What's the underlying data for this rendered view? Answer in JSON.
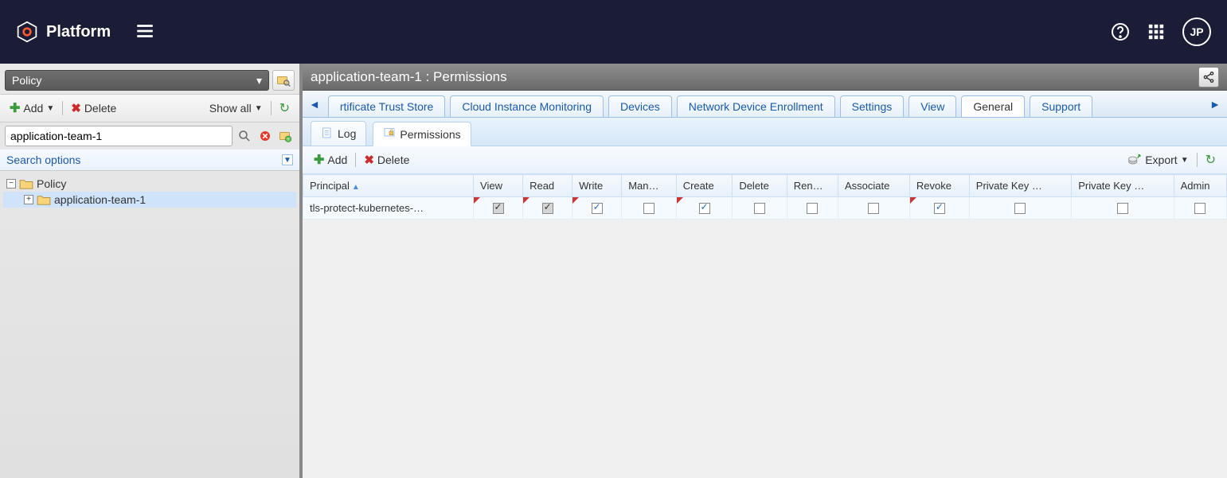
{
  "brand": {
    "name": "Platform",
    "user_initials": "JP"
  },
  "sidebar": {
    "combo_label": "Policy",
    "add_label": "Add",
    "delete_label": "Delete",
    "showall_label": "Show all",
    "search_value": "application-team-1",
    "search_options_label": "Search options",
    "tree": {
      "root": "Policy",
      "child": "application-team-1"
    }
  },
  "content": {
    "title": "application-team-1 : Permissions",
    "upper_tabs": [
      "rtificate Trust Store",
      "Cloud Instance Monitoring",
      "Devices",
      "Network Device Enrollment",
      "Settings",
      "View",
      "General",
      "Support"
    ],
    "upper_active": "General",
    "sub_tabs": {
      "log": "Log",
      "permissions": "Permissions"
    },
    "sub_active": "Permissions",
    "perm_toolbar": {
      "add": "Add",
      "delete": "Delete",
      "export": "Export"
    },
    "columns": [
      "Principal",
      "View",
      "Read",
      "Write",
      "Man…",
      "Create",
      "Delete",
      "Ren…",
      "Associate",
      "Revoke",
      "Private Key …",
      "Private Key …",
      "Admin"
    ],
    "sort_col": "Principal",
    "rows": [
      {
        "principal": "tls-protect-kubernetes-…",
        "perms": {
          "View": {
            "checked": true,
            "locked": true,
            "mark": true
          },
          "Read": {
            "checked": true,
            "locked": true,
            "mark": true
          },
          "Write": {
            "checked": true,
            "locked": false,
            "mark": true
          },
          "Man…": {
            "checked": false,
            "locked": false,
            "mark": false
          },
          "Create": {
            "checked": true,
            "locked": false,
            "mark": true
          },
          "Delete": {
            "checked": false,
            "locked": false,
            "mark": false
          },
          "Ren…": {
            "checked": false,
            "locked": false,
            "mark": false
          },
          "Associate": {
            "checked": false,
            "locked": false,
            "mark": false
          },
          "Revoke": {
            "checked": true,
            "locked": false,
            "mark": true
          },
          "Private Key …_0": {
            "checked": false,
            "locked": false,
            "mark": false
          },
          "Private Key …_1": {
            "checked": false,
            "locked": false,
            "mark": false
          },
          "Admin": {
            "checked": false,
            "locked": false,
            "mark": false
          }
        }
      }
    ]
  }
}
